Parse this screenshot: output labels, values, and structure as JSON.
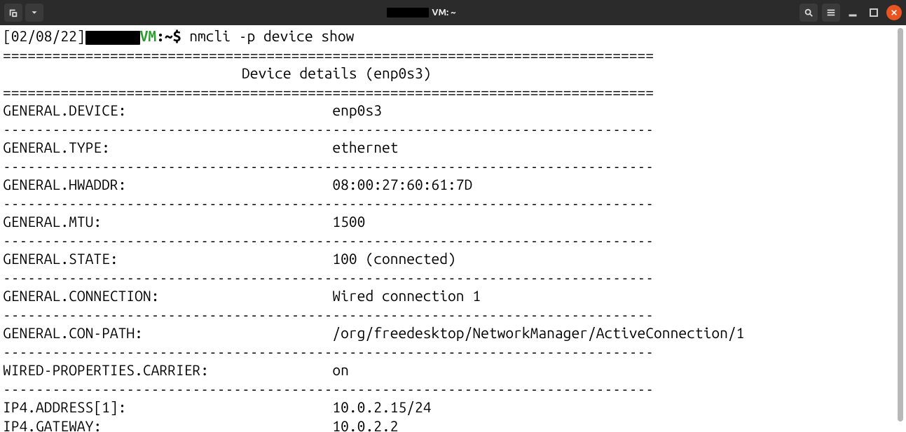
{
  "titlebar": {
    "title_suffix": "VM: ~"
  },
  "prompt": {
    "date": "[02/08/22]",
    "host_suffix": "VM",
    "path": ":~",
    "symbol": "$",
    "command": "nmcli -p device show"
  },
  "header": {
    "title": "Device details (enp0s3)"
  },
  "rows": [
    {
      "k": "GENERAL.DEVICE:",
      "v": "enp0s3"
    },
    {
      "k": "GENERAL.TYPE:",
      "v": "ethernet"
    },
    {
      "k": "GENERAL.HWADDR:",
      "v": "08:00:27:60:61:7D"
    },
    {
      "k": "GENERAL.MTU:",
      "v": "1500"
    },
    {
      "k": "GENERAL.STATE:",
      "v": "100 (connected)"
    },
    {
      "k": "GENERAL.CONNECTION:",
      "v": "Wired connection 1"
    },
    {
      "k": "GENERAL.CON-PATH:",
      "v": "/org/freedesktop/NetworkManager/ActiveConnection/1"
    },
    {
      "k": "WIRED-PROPERTIES.CARRIER:",
      "v": "on"
    },
    {
      "k": "IP4.ADDRESS[1]:",
      "v": "10.0.2.15/24"
    },
    {
      "k": "IP4.GATEWAY:",
      "v": "10.0.2.2"
    }
  ],
  "separators": {
    "eq": "===============================================================================",
    "dash": "-------------------------------------------------------------------------------",
    "header_pad": "                             "
  }
}
